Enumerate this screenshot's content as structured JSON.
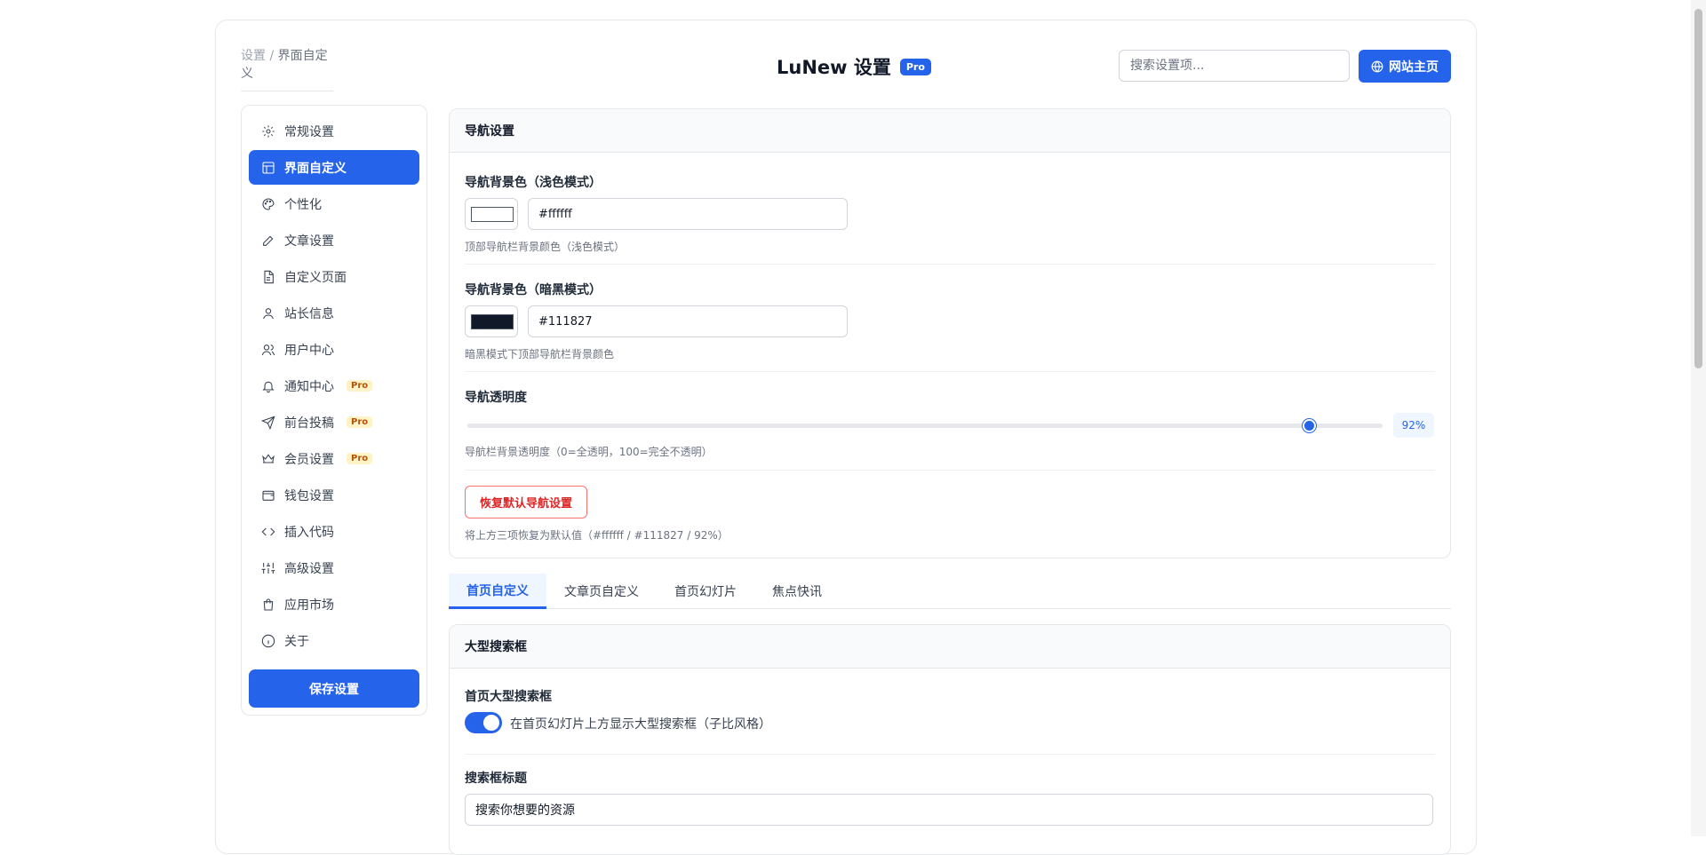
{
  "header": {
    "breadcrumb_root": "设置",
    "breadcrumb_sep": " / ",
    "breadcrumb_current": "界面自定义",
    "title": "LuNew 设置",
    "title_badge": "Pro",
    "search_placeholder": "搜索设置项...",
    "home_button_label": "网站主页"
  },
  "sidebar": {
    "items": [
      {
        "label": "常规设置",
        "icon": "gear-icon",
        "pro": ""
      },
      {
        "label": "界面自定义",
        "icon": "layout-icon",
        "pro": ""
      },
      {
        "label": "个性化",
        "icon": "palette-icon",
        "pro": ""
      },
      {
        "label": "文章设置",
        "icon": "pencil-icon",
        "pro": ""
      },
      {
        "label": "自定义页面",
        "icon": "file-icon",
        "pro": ""
      },
      {
        "label": "站长信息",
        "icon": "user-icon",
        "pro": ""
      },
      {
        "label": "用户中心",
        "icon": "users-icon",
        "pro": ""
      },
      {
        "label": "通知中心",
        "icon": "bell-icon",
        "pro": "Pro"
      },
      {
        "label": "前台投稿",
        "icon": "send-icon",
        "pro": "Pro"
      },
      {
        "label": "会员设置",
        "icon": "crown-icon",
        "pro": "Pro"
      },
      {
        "label": "钱包设置",
        "icon": "wallet-icon",
        "pro": ""
      },
      {
        "label": "插入代码",
        "icon": "code-icon",
        "pro": ""
      },
      {
        "label": "高级设置",
        "icon": "sliders-icon",
        "pro": ""
      },
      {
        "label": "应用市场",
        "icon": "shopping-bag-icon",
        "pro": ""
      },
      {
        "label": "关于",
        "icon": "info-icon",
        "pro": ""
      }
    ],
    "active_index": 1,
    "save_label": "保存设置"
  },
  "nav_panel": {
    "title": "导航设置",
    "light_bg": {
      "label": "导航背景色（浅色模式）",
      "value": "#ffffff",
      "help": "顶部导航栏背景颜色（浅色模式）",
      "swatch_color": "#ffffff"
    },
    "dark_bg": {
      "label": "导航背景色（暗黑模式）",
      "value": "#111827",
      "help": "暗黑模式下顶部导航栏背景颜色",
      "swatch_color": "#111827"
    },
    "opacity": {
      "label": "导航透明度",
      "value_text": "92%",
      "value": 92,
      "help": "导航栏背景透明度（0=全透明，100=完全不透明）"
    },
    "reset_label": "恢复默认导航设置",
    "reset_help": "将上方三项恢复为默认值（#ffffff / #111827 / 92%）"
  },
  "tabs": [
    {
      "label": "首页自定义",
      "active": true
    },
    {
      "label": "文章页自定义",
      "active": false
    },
    {
      "label": "首页幻灯片",
      "active": false
    },
    {
      "label": "焦点快讯",
      "active": false
    }
  ],
  "search_panel": {
    "title": "大型搜索框",
    "toggle_label": "首页大型搜索框",
    "toggle_desc": "在首页幻灯片上方显示大型搜索框（子比风格）",
    "toggle_on": true,
    "title_field_label": "搜索框标题",
    "title_field_value": "搜索你想要的资源"
  },
  "colors": {
    "accent": "#2563eb",
    "danger": "#dc2626",
    "pro_nav_bg": "#fef3c7"
  }
}
